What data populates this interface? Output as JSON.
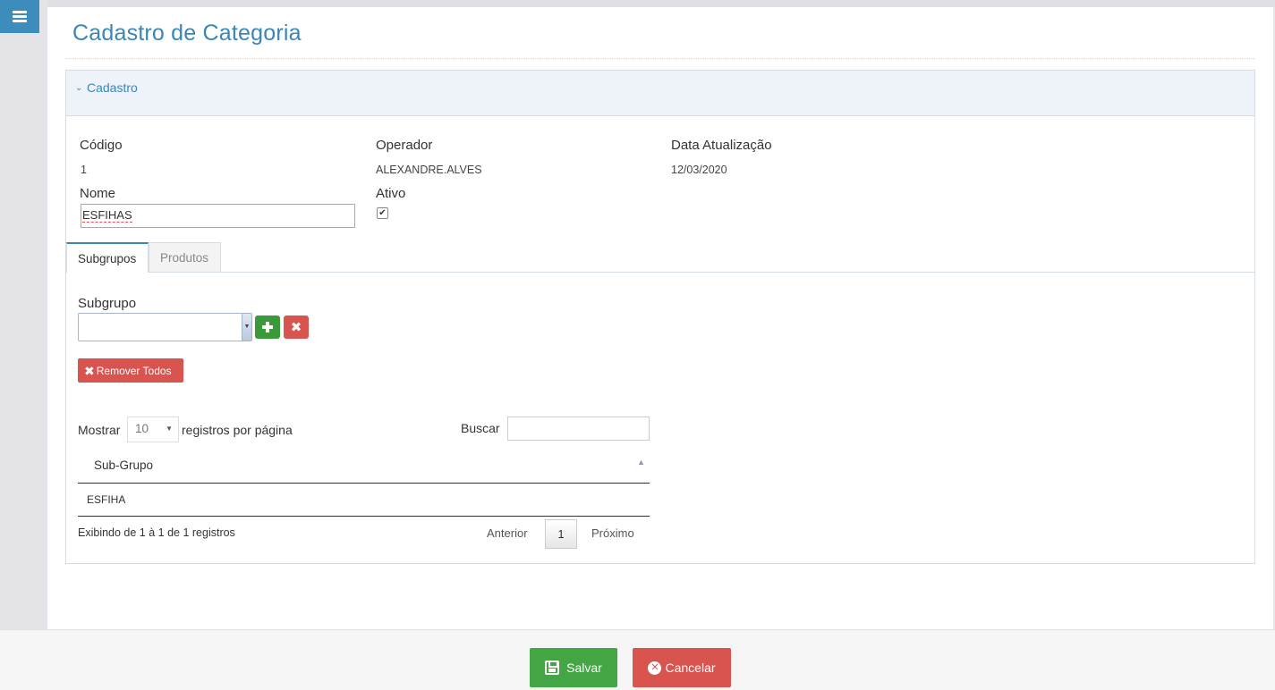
{
  "header": {
    "title": "Cadastro de Categoria"
  },
  "panel": {
    "title": "Cadastro"
  },
  "form": {
    "codigo_label": "Código",
    "codigo_value": "1",
    "operador_label": "Operador",
    "operador_value": "ALEXANDRE.ALVES",
    "data_label": "Data Atualização",
    "data_value": "12/03/2020",
    "nome_label": "Nome",
    "nome_value": "ESFIHAS",
    "ativo_label": "Ativo",
    "ativo_checked": true
  },
  "tabs": [
    {
      "label": "Subgrupos",
      "active": true
    },
    {
      "label": "Produtos",
      "active": false
    }
  ],
  "subgrupos": {
    "select_label": "Subgrupo",
    "remove_all_label": "Remover Todos",
    "show_label": "Mostrar",
    "page_size": "10",
    "per_page_label": "registros por página",
    "search_label": "Buscar",
    "column_header": "Sub-Grupo",
    "rows": [
      "ESFIHA"
    ],
    "info": "Exibindo de 1 à 1 de 1 registros",
    "prev_label": "Anterior",
    "current_page": "1",
    "next_label": "Próximo"
  },
  "footer": {
    "save_label": "Salvar",
    "cancel_label": "Cancelar"
  },
  "colors": {
    "accent": "#3a86b6",
    "success": "#44a544",
    "danger": "#d9534f"
  },
  "icons": {
    "menu": "hamburger-menu-icon",
    "collapse": "chevron-down-icon",
    "check": "check-icon",
    "add": "plus-icon",
    "remove": "x-icon",
    "save": "floppy-disk-icon",
    "cancel": "x-circle-icon",
    "sort": "sort-ascending-icon"
  }
}
